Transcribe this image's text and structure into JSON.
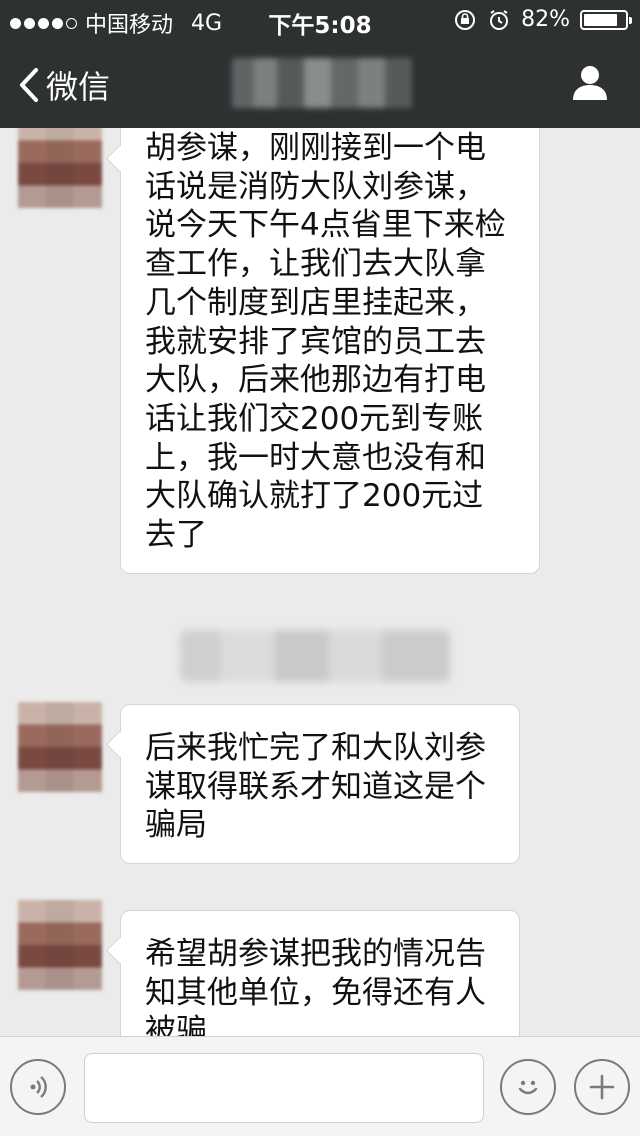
{
  "status_bar": {
    "carrier": "中国移动",
    "network": "4G",
    "time": "下午5:08",
    "battery_text": "82%",
    "battery_level": 0.82,
    "signal_dots_filled": 4,
    "signal_dots_total": 5
  },
  "nav": {
    "back_label": "微信"
  },
  "messages": [
    {
      "lines": [
        "胡参谋，刚刚接到一个电",
        "话说是消防大队刘参谋，",
        "说今天下午4点省里下来检",
        "查工作，让我们去大队拿",
        "几个制度到店里挂起来，",
        "我就安排了宾馆的员工去",
        "大队，后来他那边有打电",
        "话让我们交200元到专账",
        "上，我一时大意也没有和",
        "大队确认就打了200元过",
        "去了"
      ]
    },
    {
      "lines": [
        "后来我忙完了和大队刘参",
        "谋取得联系才知道这是个",
        "骗局"
      ]
    },
    {
      "lines": [
        "希望胡参谋把我的情况告",
        "知其他单位，免得还有人",
        "被骗"
      ]
    }
  ],
  "icons": {
    "voice": "voice-icon",
    "emoji": "emoji-icon",
    "add": "add-icon",
    "contact": "contact-icon",
    "back": "chevron-left-icon"
  },
  "colors": {
    "bar_bg": "#2e3132",
    "chat_bg": "#ebebeb",
    "bubble_bg": "#ffffff"
  }
}
